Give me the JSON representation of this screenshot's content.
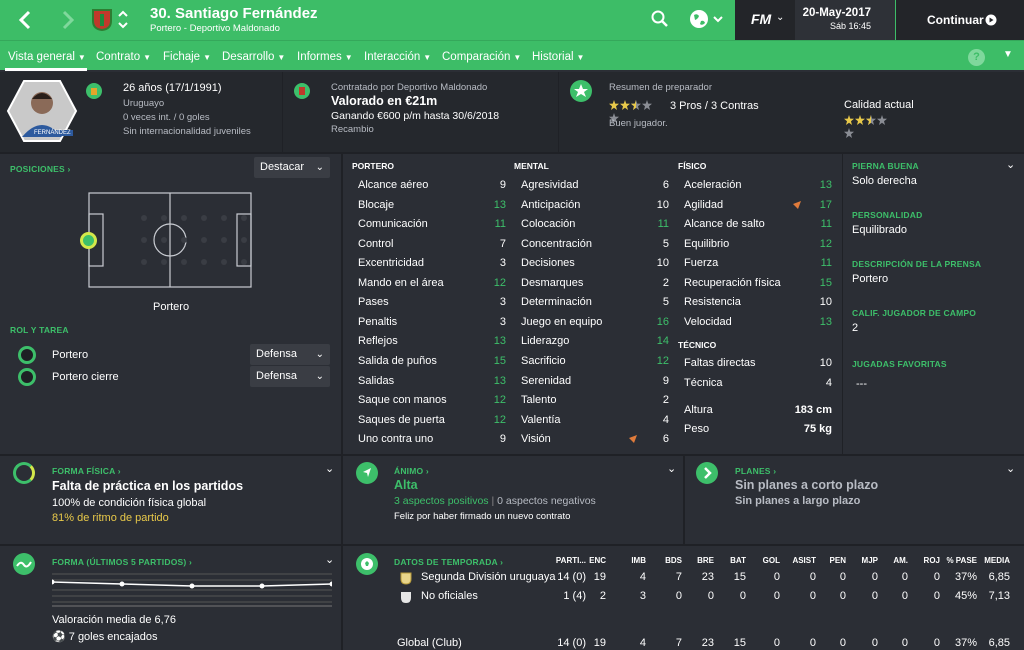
{
  "header": {
    "player_title": "30. Santiago Fernández",
    "player_sub": "Portero - Deportivo Maldonado",
    "date": "20-May-2017",
    "time": "Sáb 16:45",
    "continue_label": "Continuar",
    "fm_label": "FM"
  },
  "nav": {
    "items": [
      "Vista general",
      "Contrato",
      "Fichaje",
      "Desarrollo",
      "Informes",
      "Interacción",
      "Comparación",
      "Historial"
    ],
    "help": "?"
  },
  "info": {
    "age": "26 años",
    "dob": "(17/1/1991)",
    "nationality": "Uruguayo",
    "caps": "0 veces int. / 0 goles",
    "youth": "Sin internacionalidad juveniles",
    "card_name": "FERNÁNDEZ",
    "contract_by": "Contratado por Deportivo Maldonado",
    "value": "Valorado en €21m",
    "wage": "Ganando €600 p/m hasta 30/6/2018",
    "role": "Recambio",
    "coach_title": "Resumen de preparador",
    "pros_cons": "3 Pros / 3 Contras",
    "coach_text": "Buen jugador.",
    "ability_label": "Calidad actual",
    "coach_stars": 2.5,
    "ability_stars": 2.5
  },
  "positions": {
    "label": "POSICIONES",
    "highlight": "Destacar",
    "pitch_label": "Portero",
    "role_label": "ROL Y TAREA",
    "roles": [
      {
        "name": "Portero",
        "duty": "Defensa"
      },
      {
        "name": "Portero cierre",
        "duty": "Defensa"
      }
    ]
  },
  "attributes": {
    "gk_header": "PORTERO",
    "mental_header": "MENTAL",
    "physical_header": "FÍSICO",
    "technical_header": "TÉCNICO",
    "goalkeeping": [
      {
        "n": "Alcance aéreo",
        "v": "9"
      },
      {
        "n": "Blocaje",
        "v": "13"
      },
      {
        "n": "Comunicación",
        "v": "11"
      },
      {
        "n": "Control",
        "v": "7"
      },
      {
        "n": "Excentricidad",
        "v": "3"
      },
      {
        "n": "Mando en el área",
        "v": "12"
      },
      {
        "n": "Pases",
        "v": "3"
      },
      {
        "n": "Penaltis",
        "v": "3"
      },
      {
        "n": "Reflejos",
        "v": "13"
      },
      {
        "n": "Salida de puños",
        "v": "15"
      },
      {
        "n": "Salidas",
        "v": "13"
      },
      {
        "n": "Saque con manos",
        "v": "12"
      },
      {
        "n": "Saques de puerta",
        "v": "12"
      },
      {
        "n": "Uno contra uno",
        "v": "9"
      }
    ],
    "mental": [
      {
        "n": "Agresividad",
        "v": "6"
      },
      {
        "n": "Anticipación",
        "v": "10"
      },
      {
        "n": "Colocación",
        "v": "11"
      },
      {
        "n": "Concentración",
        "v": "5"
      },
      {
        "n": "Decisiones",
        "v": "10"
      },
      {
        "n": "Desmarques",
        "v": "2"
      },
      {
        "n": "Determinación",
        "v": "5"
      },
      {
        "n": "Juego en equipo",
        "v": "16"
      },
      {
        "n": "Liderazgo",
        "v": "14"
      },
      {
        "n": "Sacrificio",
        "v": "12"
      },
      {
        "n": "Serenidad",
        "v": "9"
      },
      {
        "n": "Talento",
        "v": "2"
      },
      {
        "n": "Valentía",
        "v": "4"
      },
      {
        "n": "Visión",
        "v": "6"
      }
    ],
    "physical": [
      {
        "n": "Aceleración",
        "v": "13"
      },
      {
        "n": "Agilidad",
        "v": "17"
      },
      {
        "n": "Alcance de salto",
        "v": "11"
      },
      {
        "n": "Equilibrio",
        "v": "12"
      },
      {
        "n": "Fuerza",
        "v": "11"
      },
      {
        "n": "Recuperación física",
        "v": "15"
      },
      {
        "n": "Resistencia",
        "v": "10"
      },
      {
        "n": "Velocidad",
        "v": "13"
      }
    ],
    "technical": [
      {
        "n": "Faltas directas",
        "v": "10"
      },
      {
        "n": "Técnica",
        "v": "4"
      }
    ],
    "height_label": "Altura",
    "height": "183 cm",
    "weight_label": "Peso",
    "weight": "75 kg"
  },
  "right_info": {
    "foot_label": "PIERNA BUENA",
    "foot": "Solo derecha",
    "personality_label": "PERSONALIDAD",
    "personality": "Equilibrado",
    "press_label": "DESCRIPCIÓN DE LA PRENSA",
    "press": "Portero",
    "outfield_label": "CALIF. JUGADOR DE CAMPO",
    "outfield": "2",
    "moves_label": "JUGADAS FAVORITAS",
    "moves": "---"
  },
  "fitness": {
    "label": "FORMA FÍSICA",
    "title": "Falta de práctica en los partidos",
    "cond": "100% de condición física global",
    "sharp": "81% de ritmo de partido"
  },
  "morale": {
    "label": "ÁNIMO",
    "value": "Alta",
    "pos": "3 aspectos positivos",
    "sep": "|",
    "neg": "0 aspectos negativos",
    "text": "Feliz por haber firmado un nuevo contrato"
  },
  "plans": {
    "label": "PLANES",
    "short": "Sin planes a corto plazo",
    "long": "Sin planes a largo plazo"
  },
  "form": {
    "label": "FORMA (ÚLTIMOS 5 PARTIDOS)",
    "avg": "Valoración media de 6,76",
    "goals": "7 goles encajados",
    "ratings": [
      6.9,
      6.8,
      6.7,
      6.7,
      6.8
    ]
  },
  "season": {
    "label": "DATOS DE TEMPORADA",
    "headers": [
      "PARTI...",
      "ENC",
      "IMB",
      "BDS",
      "BRE",
      "BAT",
      "GOL",
      "ASIST",
      "PEN",
      "MJP",
      "AM.",
      "ROJ",
      "% PASE",
      "MEDIA"
    ],
    "rows": [
      {
        "name": "Segunda División uruguaya",
        "vals": [
          "14 (0)",
          "19",
          "4",
          "7",
          "23",
          "15",
          "0",
          "0",
          "0",
          "0",
          "0",
          "0",
          "37%",
          "6,85"
        ]
      },
      {
        "name": "No oficiales",
        "vals": [
          "1 (4)",
          "2",
          "3",
          "0",
          "0",
          "0",
          "0",
          "0",
          "0",
          "0",
          "0",
          "0",
          "45%",
          "7,13"
        ]
      },
      {
        "name": "Global (Club)",
        "vals": [
          "14 (0)",
          "19",
          "4",
          "7",
          "23",
          "15",
          "0",
          "0",
          "0",
          "0",
          "0",
          "0",
          "37%",
          "6,85"
        ]
      }
    ]
  },
  "colors": {
    "accent": "#3dbd67",
    "bg": "#2b2e35",
    "dark": "#232529"
  }
}
